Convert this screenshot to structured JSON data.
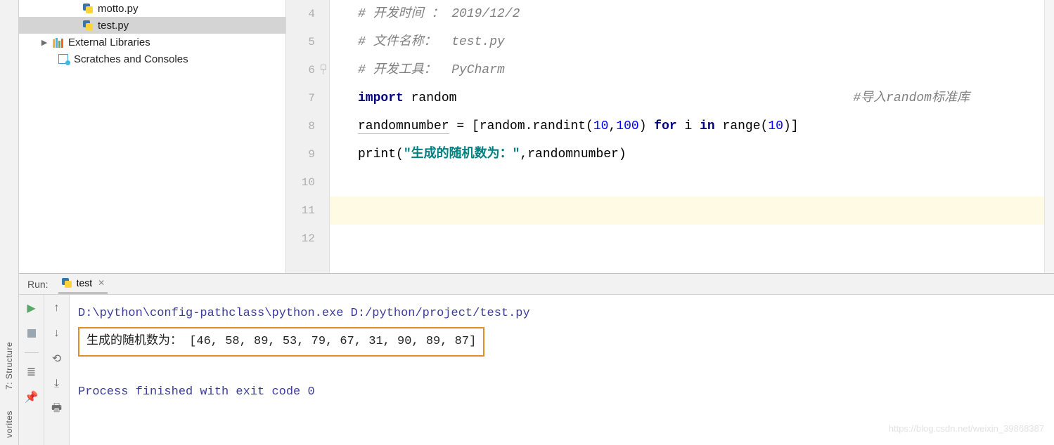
{
  "tree": {
    "motto": "motto.py",
    "test": "test.py",
    "ext_lib": "External Libraries",
    "scratches": "Scratches and Consoles"
  },
  "gutter": [
    "4",
    "5",
    "6",
    "7",
    "8",
    "9",
    "10",
    "11",
    "12"
  ],
  "code": {
    "l4": "# 开发时间 ： 2019/12/2",
    "l5": "# 文件名称：  test.py",
    "l6": "# 开发工具：  PyCharm",
    "l7_kw": "import",
    "l7_id": " random",
    "l7_cm": "#导入random标准库",
    "l8_var": "randomnumber",
    "l8_a": " = [random.randint(",
    "l8_n1": "10",
    "l8_c1": ",",
    "l8_n2": "100",
    "l8_b": ") ",
    "l8_for": "for",
    "l8_i": " i ",
    "l8_in": "in",
    "l8_r": " range(",
    "l8_n3": "10",
    "l8_e": ")]",
    "l9_p": "print",
    "l9_op": "(",
    "l9_s": "\"生成的随机数为：\"",
    "l9_rest": ",randomnumber)"
  },
  "rail": {
    "structure": "7: Structure",
    "favorites": "vorites"
  },
  "run": {
    "label": "Run:",
    "tab": "test",
    "cmd": "D:\\python\\config-pathclass\\python.exe D:/python/project/test.py",
    "out": "生成的随机数为： [46, 58, 89, 53, 79, 67, 31, 90, 89, 87]",
    "exit": "Process finished with exit code 0"
  },
  "watermark": "https://blog.csdn.net/weixin_39868387"
}
